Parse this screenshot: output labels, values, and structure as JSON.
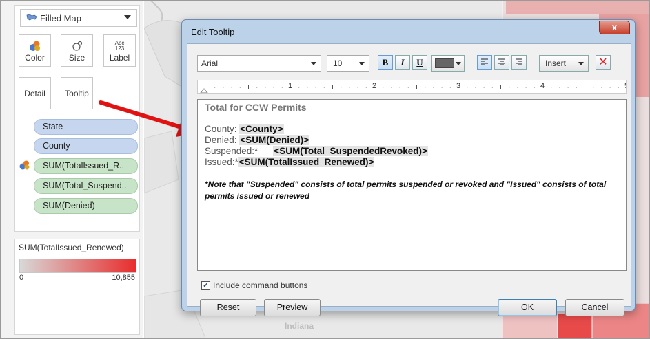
{
  "marks": {
    "mark_type": "Filled Map",
    "buttons": {
      "color": "Color",
      "size": "Size",
      "label": "Label",
      "label_icon": "Abc 123",
      "detail": "Detail",
      "tooltip": "Tooltip"
    },
    "pills": [
      {
        "label": "State",
        "kind": "detail"
      },
      {
        "label": "County",
        "kind": "detail"
      },
      {
        "label": "SUM(TotalIssued_R..",
        "kind": "color"
      },
      {
        "label": "SUM(Total_Suspend..",
        "kind": "tooltip"
      },
      {
        "label": "SUM(Denied)",
        "kind": "tooltip"
      }
    ]
  },
  "legend": {
    "title": "SUM(TotalIssued_Renewed)",
    "min": "0",
    "max": "10,855",
    "color_low": "#d8d8d8",
    "color_high": "#e82d2d"
  },
  "map": {
    "label": "Indiana"
  },
  "dialog": {
    "title": "Edit Tooltip",
    "close_label": "x",
    "font": "Arial",
    "size": "10",
    "bold": "B",
    "italic": "I",
    "underline": "U",
    "insert": "Insert",
    "ruler": [
      "1",
      "2",
      "3",
      "4",
      "5"
    ],
    "editor": {
      "title": "Total for CCW Permits",
      "lines": [
        {
          "label": "County:",
          "field": "<County>"
        },
        {
          "label": "Denied:",
          "field": "<SUM(Denied)>"
        },
        {
          "label": "Suspended:*",
          "field": "<SUM(Total_SuspendedRevoked)>"
        },
        {
          "label": "Issued:*",
          "field": "<SUM(TotalIssued_Renewed)>"
        }
      ],
      "note": "*Note that \"Suspended\" consists of total permits suspended or revoked and \"Issued\" consists of total permits issued or renewed"
    },
    "include_buttons_label": "Include command buttons",
    "include_buttons_checked": true,
    "reset": "Reset",
    "preview": "Preview",
    "ok": "OK",
    "cancel": "Cancel"
  }
}
